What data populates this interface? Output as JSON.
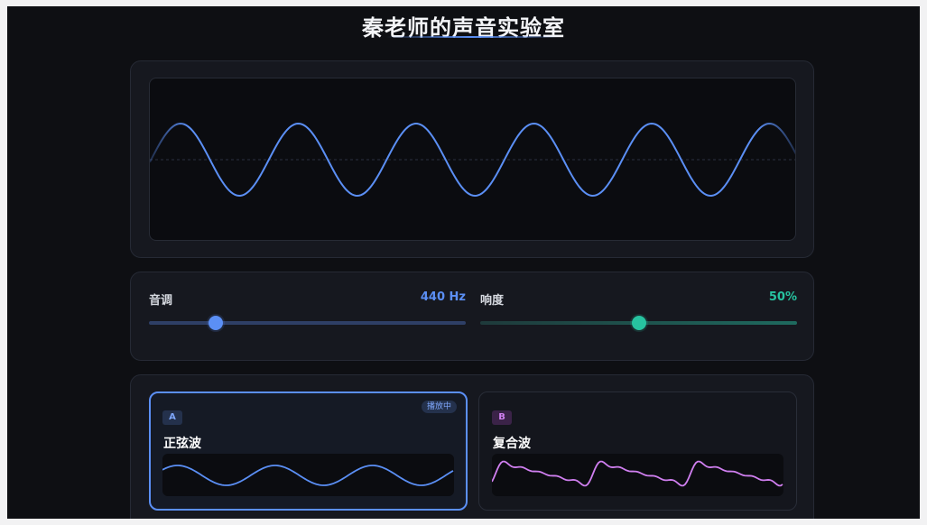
{
  "header": {
    "title": "秦老师的声音实验室"
  },
  "oscilloscope": {
    "waveform": "sine",
    "color": "#5b8ff5"
  },
  "controls": {
    "pitch": {
      "label": "音调",
      "value_text": "440 Hz",
      "level": 0.21,
      "color": "#5b8ff5"
    },
    "volume": {
      "label": "响度",
      "value_text": "50%",
      "level": 0.5,
      "color": "#27c3a0"
    }
  },
  "cards": [
    {
      "badge": "A",
      "name": "正弦波",
      "status": "播放中",
      "color": "#5b8ff5",
      "selected": true
    },
    {
      "badge": "B",
      "name": "复合波",
      "color": "#d07ff0",
      "selected": false
    }
  ]
}
